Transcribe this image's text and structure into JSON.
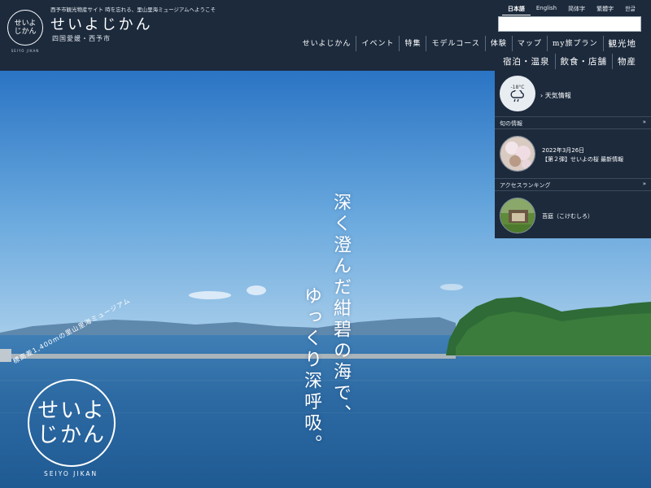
{
  "header": {
    "tagline": "西予市観光物産サイト 時を忘れる、里山里海ミュージアムへようこそ",
    "brand": "せいよじかん",
    "region": "四国愛媛・西予市",
    "logo_lines": [
      "せいよ",
      "じかん"
    ],
    "logo_small": "SEIYO JIKAN",
    "languages": [
      {
        "label": "日本語",
        "active": true
      },
      {
        "label": "English"
      },
      {
        "label": "简体字"
      },
      {
        "label": "繁體字"
      },
      {
        "label": "한글"
      }
    ],
    "search_placeholder": ""
  },
  "nav": {
    "row1": [
      "せいよじかん",
      "イベント",
      "特集",
      "モデルコース",
      "体験",
      "マップ",
      "my旅プラン",
      "観光地"
    ],
    "row2": [
      "宿泊・温泉",
      "飲食・店舗",
      "物産"
    ]
  },
  "hero": {
    "line1": "深く澄んだ紺碧の海で、",
    "line2": "ゆっくり深呼吸。",
    "logo_lines": [
      "せいよ",
      "じかん"
    ],
    "arc_text": "標高差1,400mの里山里海ミュージアム",
    "roman": "SEIYO JIKAN"
  },
  "panel": {
    "weather": {
      "temp": "-18°C",
      "label": "天気情報",
      "icon": "cloud-rain-icon"
    },
    "news": {
      "heading": "旬の情報",
      "date": "2022年3月26日",
      "title": "【第２弾】せいよの桜 最新情報"
    },
    "ranking": {
      "heading": "アクセスランキング",
      "title": "苔庭（こけむしろ）"
    }
  },
  "colors": {
    "header_bg": "#1c2a3c",
    "sky_top": "#2e78c6",
    "sea": "#2d6aa3"
  }
}
